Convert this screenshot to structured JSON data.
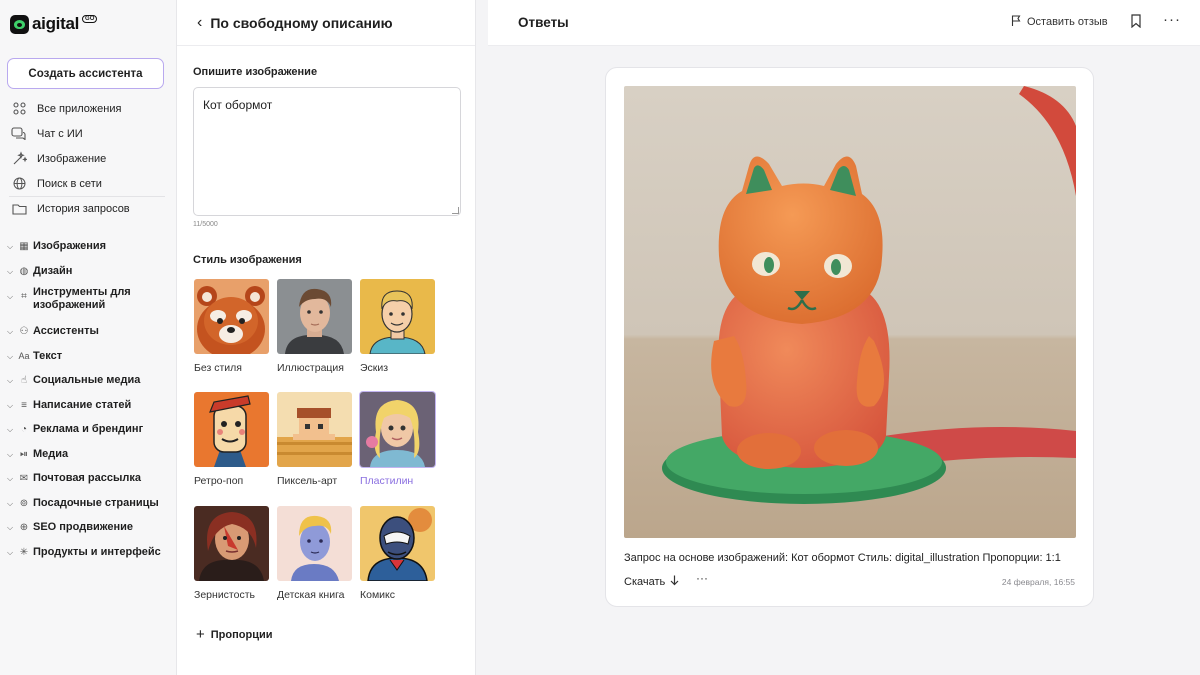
{
  "brand": {
    "name": "aigital",
    "badge": "GO"
  },
  "sidebar": {
    "create_button": "Создать ассистента",
    "items": [
      {
        "label": "Все приложения",
        "icon": "grid-icon"
      },
      {
        "label": "Чат с ИИ",
        "icon": "chat-icon"
      },
      {
        "label": "Изображение",
        "icon": "image-magic-icon"
      },
      {
        "label": "Поиск в сети",
        "icon": "globe-icon"
      },
      {
        "label": "История запросов",
        "icon": "folder-icon"
      }
    ],
    "groups": [
      {
        "label": "Изображения",
        "icon": "image-icon"
      },
      {
        "label": "Дизайн",
        "icon": "palette-icon"
      },
      {
        "label": "Инструменты для изображений",
        "icon": "crop-icon"
      },
      {
        "label": "Ассистенты",
        "icon": "people-icon"
      },
      {
        "label": "Текст",
        "icon": "text-icon"
      },
      {
        "label": "Социальные медиа",
        "icon": "thumbs-up-icon"
      },
      {
        "label": "Написание статей",
        "icon": "lines-icon"
      },
      {
        "label": "Реклама и брендинг",
        "icon": "megaphone-icon"
      },
      {
        "label": "Медиа",
        "icon": "media-icon"
      },
      {
        "label": "Почтовая рассылка",
        "icon": "mail-icon"
      },
      {
        "label": "Посадочные страницы",
        "icon": "landing-icon"
      },
      {
        "label": "SEO продвижение",
        "icon": "seo-icon"
      },
      {
        "label": "Продукты и интерфейс",
        "icon": "sparkle-icon"
      }
    ]
  },
  "editor": {
    "title": "По свободному описанию",
    "describe_label": "Опишите изображение",
    "description_value": "Кот обормот",
    "counter": "11/5000",
    "style_label": "Стиль изображения",
    "styles": [
      {
        "name": "Без стиля",
        "selected": false
      },
      {
        "name": "Иллюстрация",
        "selected": false
      },
      {
        "name": "Эскиз",
        "selected": false
      },
      {
        "name": "Ретро-поп",
        "selected": false
      },
      {
        "name": "Пиксель-арт",
        "selected": false
      },
      {
        "name": "Пластилин",
        "selected": true
      },
      {
        "name": "Зернистость",
        "selected": false
      },
      {
        "name": "Детская книга",
        "selected": false
      },
      {
        "name": "Комикс",
        "selected": false
      }
    ],
    "proportions_label": "Пропорции"
  },
  "answers": {
    "title": "Ответы",
    "feedback_label": "Оставить отзыв",
    "result": {
      "caption": "Запрос на основе изображений: Кот обормот Стиль: digital_illustration Пропорции: 1:1",
      "download_label": "Скачать",
      "timestamp": "24 февраля, 16:55"
    }
  },
  "colors": {
    "accent": "#8a6fe0",
    "accent_border": "#b9a9ef",
    "brand_green": "#3ed16a"
  }
}
